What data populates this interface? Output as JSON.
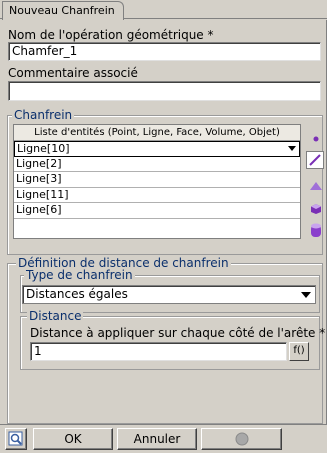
{
  "tab": {
    "title": "Nouveau Chanfrein"
  },
  "form": {
    "name_label": "Nom de l'opération géométrique *",
    "name_value": "Chamfer_1",
    "comment_label": "Commentaire associé",
    "comment_value": ""
  },
  "chanfrein": {
    "title": "Chanfrein",
    "list_header": "Liste d'entités (Point, Ligne, Face, Volume, Objet)",
    "items": [
      "Ligne[10]",
      "Ligne[2]",
      "Ligne[3]",
      "Ligne[11]",
      "Ligne[6]"
    ],
    "tools": [
      "point-icon",
      "line-icon",
      "face-icon",
      "volume-icon",
      "object-icon"
    ]
  },
  "distance_def": {
    "title": "Définition de distance de chanfrein",
    "type_title": "Type de chanfrein",
    "type_value": "Distances égales",
    "distance_title": "Distance",
    "distance_label": "Distance à appliquer sur chaque côté de l'arête *",
    "distance_value": "1",
    "function_button": "f()"
  },
  "buttons": {
    "ok": "OK",
    "cancel": "Annuler"
  },
  "colors": {
    "accent": "#7a2fb5",
    "group_title": "#0a2f6c"
  }
}
